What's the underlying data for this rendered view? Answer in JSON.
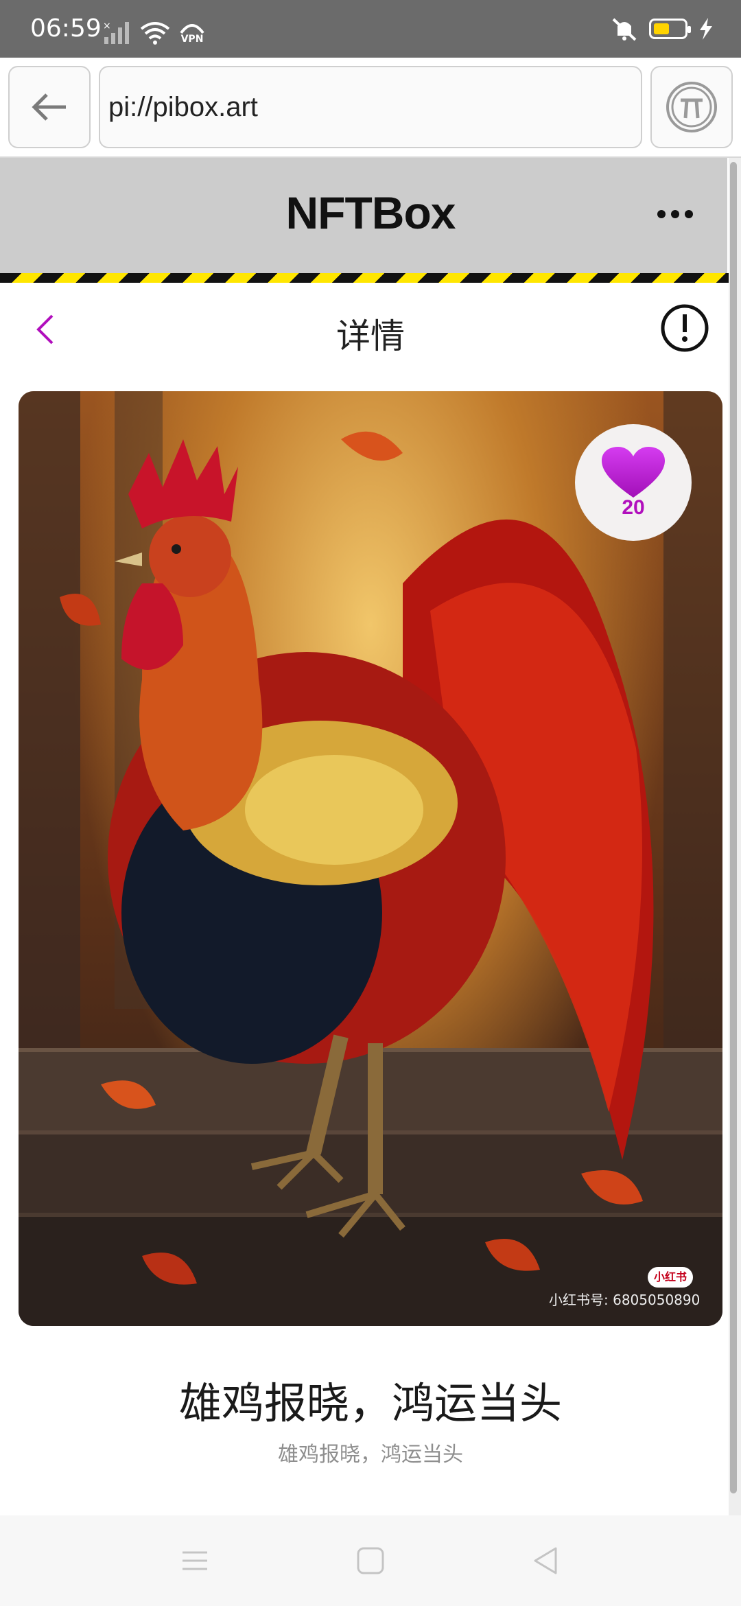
{
  "status_bar": {
    "time": "06:59",
    "vpn_label": "VPN",
    "icons": [
      "signal-icon",
      "wifi-icon",
      "vpn-icon",
      "mute-icon",
      "battery-icon",
      "charging-icon"
    ],
    "battery_level": 0.5,
    "battery_color": "#ffd400"
  },
  "browser": {
    "url": "pi://pibox.art",
    "back_icon": "arrow-left-icon",
    "pi_icon": "pi-logo-icon"
  },
  "app_header": {
    "title": "NFTBox",
    "menu_icon": "more-dots-icon"
  },
  "detail": {
    "title": "详情",
    "back_icon": "chevron-left-icon",
    "info_icon": "info-icon",
    "accent_color": "#b10fbd"
  },
  "artwork": {
    "likes": "20",
    "watermark_logo": "小红书",
    "watermark_text": "小红书号: 6805050890",
    "title": "雄鸡报晓，鸿运当头",
    "subtitle": "雄鸡报晓，鸿运当头"
  },
  "system_nav": {
    "icons": [
      "menu-icon",
      "home-icon",
      "back-icon"
    ]
  }
}
